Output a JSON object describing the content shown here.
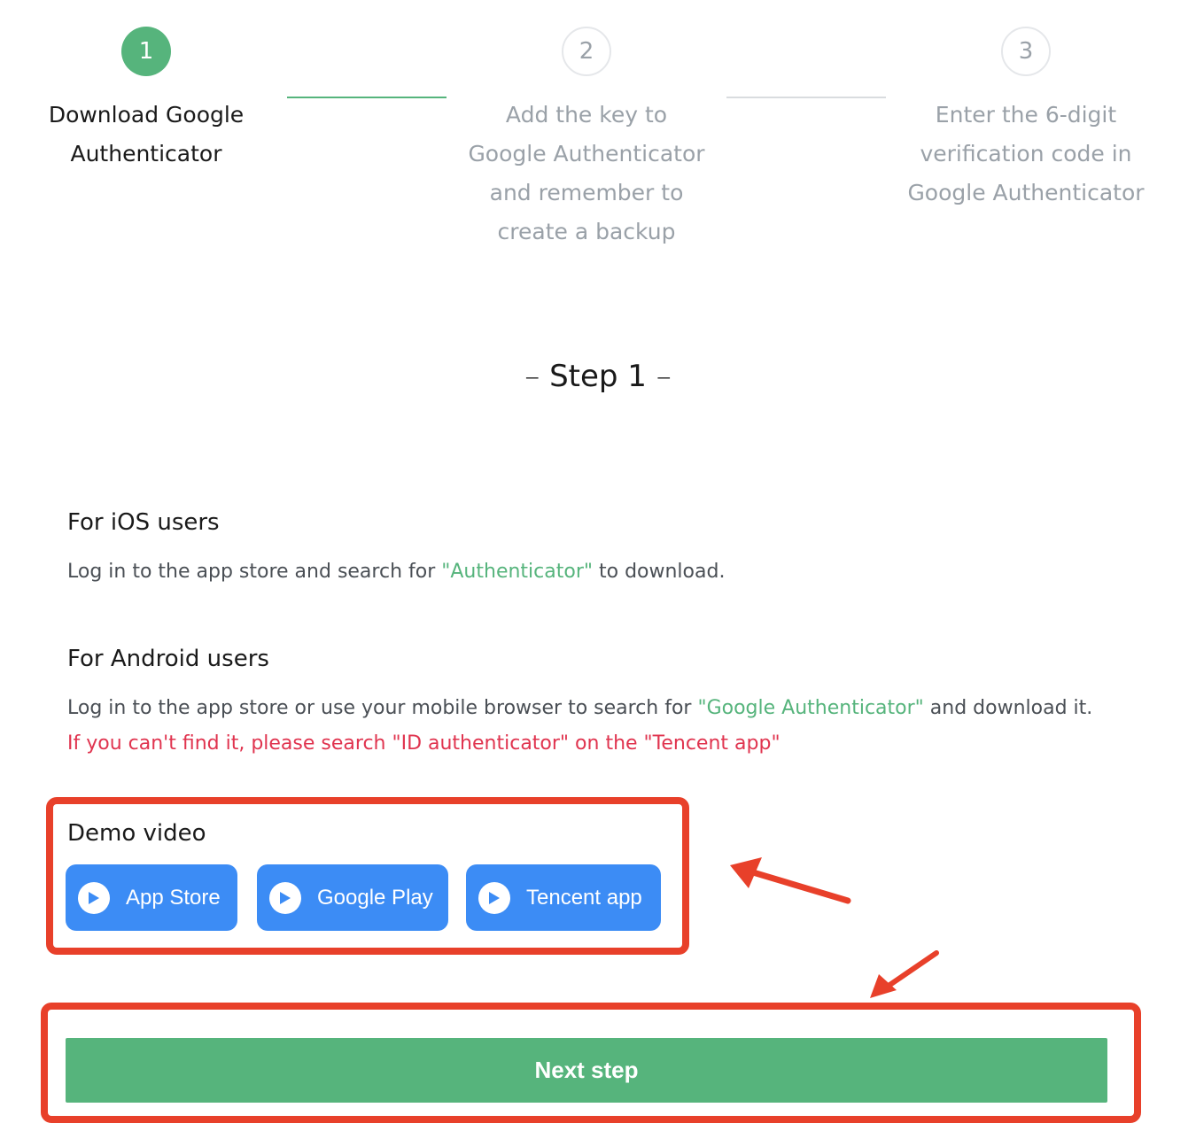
{
  "stepper": {
    "steps": [
      {
        "number": "1",
        "label": "Download Google Authenticator",
        "state": "active"
      },
      {
        "number": "2",
        "label": "Add the key to Google Authenticator and remember to create a backup",
        "state": "inactive"
      },
      {
        "number": "3",
        "label": "Enter the 6-digit verification code in Google Authenticator",
        "state": "inactive"
      }
    ]
  },
  "current_step": {
    "dash_left": "–",
    "title": "Step 1",
    "dash_right": "–"
  },
  "ios": {
    "title": "For iOS users",
    "text_before": "Log in to the app store and search for ",
    "highlight": "\"Authenticator\"",
    "text_after": " to download."
  },
  "android": {
    "title": "For Android users",
    "text_before": "Log in to the app store or use your mobile browser to search for ",
    "highlight": "\"Google Authenticator\"",
    "text_after": " and download it.",
    "warning": "If you can't find it, please search \"ID authenticator\" on the \"Tencent app\""
  },
  "demo_video": {
    "title": "Demo video",
    "buttons": [
      {
        "label": "App Store",
        "icon": "play-icon"
      },
      {
        "label": "Google Play",
        "icon": "play-icon"
      },
      {
        "label": "Tencent app",
        "icon": "play-icon"
      }
    ]
  },
  "next_button": {
    "label": "Next step"
  },
  "colors": {
    "accent_green": "#56b47c",
    "button_blue": "#3c8cf5",
    "warning_red": "#e0344f",
    "annotation_red": "#e8402a",
    "inactive_gray": "#9aa1a8"
  }
}
